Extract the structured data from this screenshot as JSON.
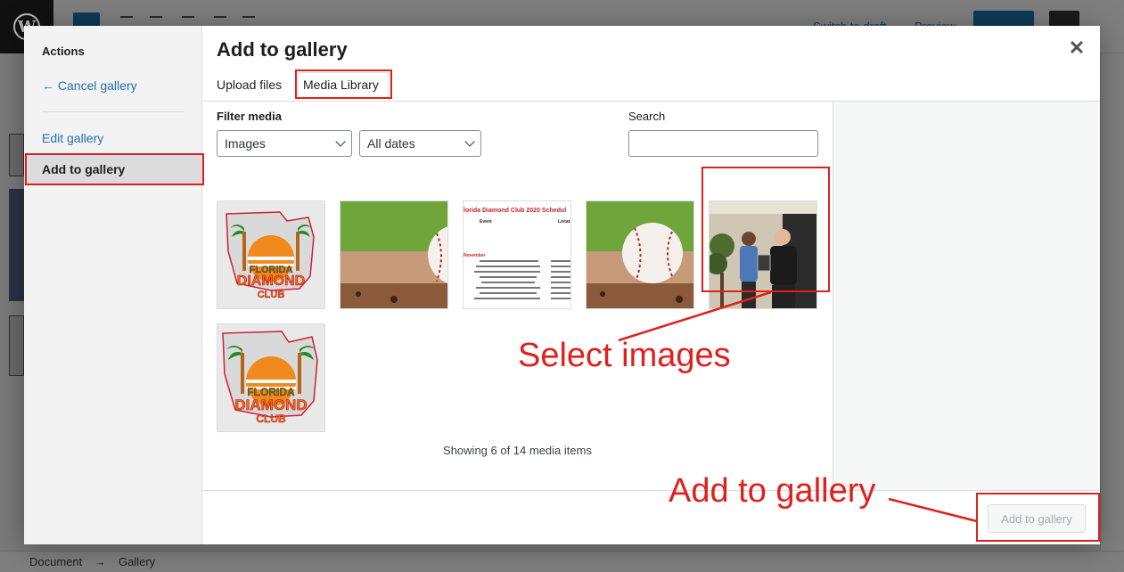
{
  "background": {
    "header": {
      "switch_to_draft": "Switch to draft",
      "preview": "Preview"
    },
    "footer": {
      "crumb_document": "Document",
      "crumb_separator": "→",
      "crumb_gallery": "Gallery"
    }
  },
  "modal": {
    "title": "Add to gallery",
    "close_icon_glyph": "✕",
    "sidebar": {
      "heading": "Actions",
      "cancel_gallery": "← Cancel gallery",
      "edit_gallery": "Edit gallery",
      "add_to_gallery": "Add to gallery"
    },
    "tabs": [
      {
        "label": "Upload files"
      },
      {
        "label": "Media Library",
        "active": true
      }
    ],
    "filter": {
      "label": "Filter media",
      "type_selected": "Images",
      "date_selected": "All dates"
    },
    "search": {
      "label": "Search",
      "value": ""
    },
    "media_items": [
      {
        "name": "florida-diamond-club-logo",
        "selected": false
      },
      {
        "name": "baseball-on-dirt",
        "selected": false
      },
      {
        "name": "florida-diamond-club-2020-schedule",
        "selected": false
      },
      {
        "name": "baseball-on-dirt-2",
        "selected": false
      },
      {
        "name": "award-photo-two-men",
        "selected": true
      },
      {
        "name": "florida-diamond-club-logo-2",
        "selected": false
      }
    ],
    "schedule_thumb": {
      "title": "lorida Diamond Club 2020 Schedul",
      "col_event": "Event",
      "col_location": "Locat",
      "month": "November"
    },
    "logo_text": {
      "line1": "FLORIDA",
      "line2": "DIAMOND",
      "line3": "CLUB"
    },
    "status": "Showing 6 of 14 media items",
    "add_button": "Add to gallery"
  },
  "annotations": {
    "select_images": "Select images",
    "add_to_gallery": "Add to gallery",
    "color": "#e0201c"
  }
}
